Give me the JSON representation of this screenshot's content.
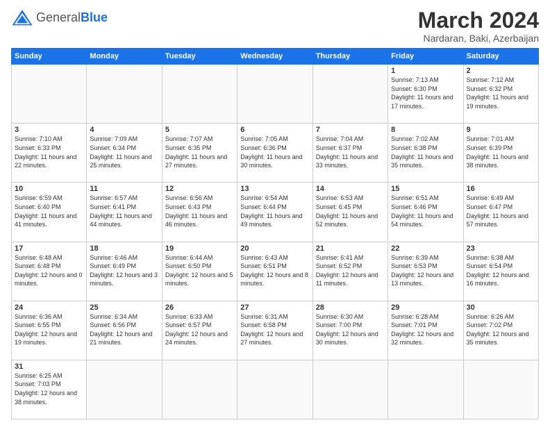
{
  "header": {
    "logo_general": "General",
    "logo_blue": "Blue",
    "title": "March 2024",
    "subtitle": "Nardaran, Baki, Azerbaijan"
  },
  "weekdays": [
    "Sunday",
    "Monday",
    "Tuesday",
    "Wednesday",
    "Thursday",
    "Friday",
    "Saturday"
  ],
  "weeks": [
    [
      {
        "day": "",
        "info": ""
      },
      {
        "day": "",
        "info": ""
      },
      {
        "day": "",
        "info": ""
      },
      {
        "day": "",
        "info": ""
      },
      {
        "day": "",
        "info": ""
      },
      {
        "day": "1",
        "info": "Sunrise: 7:13 AM\nSunset: 6:30 PM\nDaylight: 11 hours\nand 17 minutes."
      },
      {
        "day": "2",
        "info": "Sunrise: 7:12 AM\nSunset: 6:32 PM\nDaylight: 11 hours\nand 19 minutes."
      }
    ],
    [
      {
        "day": "3",
        "info": "Sunrise: 7:10 AM\nSunset: 6:33 PM\nDaylight: 11 hours\nand 22 minutes."
      },
      {
        "day": "4",
        "info": "Sunrise: 7:09 AM\nSunset: 6:34 PM\nDaylight: 11 hours\nand 25 minutes."
      },
      {
        "day": "5",
        "info": "Sunrise: 7:07 AM\nSunset: 6:35 PM\nDaylight: 11 hours\nand 27 minutes."
      },
      {
        "day": "6",
        "info": "Sunrise: 7:05 AM\nSunset: 6:36 PM\nDaylight: 11 hours\nand 30 minutes."
      },
      {
        "day": "7",
        "info": "Sunrise: 7:04 AM\nSunset: 6:37 PM\nDaylight: 11 hours\nand 33 minutes."
      },
      {
        "day": "8",
        "info": "Sunrise: 7:02 AM\nSunset: 6:38 PM\nDaylight: 11 hours\nand 35 minutes."
      },
      {
        "day": "9",
        "info": "Sunrise: 7:01 AM\nSunset: 6:39 PM\nDaylight: 11 hours\nand 38 minutes."
      }
    ],
    [
      {
        "day": "10",
        "info": "Sunrise: 6:59 AM\nSunset: 6:40 PM\nDaylight: 11 hours\nand 41 minutes."
      },
      {
        "day": "11",
        "info": "Sunrise: 6:57 AM\nSunset: 6:41 PM\nDaylight: 11 hours\nand 44 minutes."
      },
      {
        "day": "12",
        "info": "Sunrise: 6:56 AM\nSunset: 6:43 PM\nDaylight: 11 hours\nand 46 minutes."
      },
      {
        "day": "13",
        "info": "Sunrise: 6:54 AM\nSunset: 6:44 PM\nDaylight: 11 hours\nand 49 minutes."
      },
      {
        "day": "14",
        "info": "Sunrise: 6:53 AM\nSunset: 6:45 PM\nDaylight: 11 hours\nand 52 minutes."
      },
      {
        "day": "15",
        "info": "Sunrise: 6:51 AM\nSunset: 6:46 PM\nDaylight: 11 hours\nand 54 minutes."
      },
      {
        "day": "16",
        "info": "Sunrise: 6:49 AM\nSunset: 6:47 PM\nDaylight: 11 hours\nand 57 minutes."
      }
    ],
    [
      {
        "day": "17",
        "info": "Sunrise: 6:48 AM\nSunset: 6:48 PM\nDaylight: 12 hours\nand 0 minutes."
      },
      {
        "day": "18",
        "info": "Sunrise: 6:46 AM\nSunset: 6:49 PM\nDaylight: 12 hours\nand 3 minutes."
      },
      {
        "day": "19",
        "info": "Sunrise: 6:44 AM\nSunset: 6:50 PM\nDaylight: 12 hours\nand 5 minutes."
      },
      {
        "day": "20",
        "info": "Sunrise: 6:43 AM\nSunset: 6:51 PM\nDaylight: 12 hours\nand 8 minutes."
      },
      {
        "day": "21",
        "info": "Sunrise: 6:41 AM\nSunset: 6:52 PM\nDaylight: 12 hours\nand 11 minutes."
      },
      {
        "day": "22",
        "info": "Sunrise: 6:39 AM\nSunset: 6:53 PM\nDaylight: 12 hours\nand 13 minutes."
      },
      {
        "day": "23",
        "info": "Sunrise: 6:38 AM\nSunset: 6:54 PM\nDaylight: 12 hours\nand 16 minutes."
      }
    ],
    [
      {
        "day": "24",
        "info": "Sunrise: 6:36 AM\nSunset: 6:55 PM\nDaylight: 12 hours\nand 19 minutes."
      },
      {
        "day": "25",
        "info": "Sunrise: 6:34 AM\nSunset: 6:56 PM\nDaylight: 12 hours\nand 21 minutes."
      },
      {
        "day": "26",
        "info": "Sunrise: 6:33 AM\nSunset: 6:57 PM\nDaylight: 12 hours\nand 24 minutes."
      },
      {
        "day": "27",
        "info": "Sunrise: 6:31 AM\nSunset: 6:58 PM\nDaylight: 12 hours\nand 27 minutes."
      },
      {
        "day": "28",
        "info": "Sunrise: 6:30 AM\nSunset: 7:00 PM\nDaylight: 12 hours\nand 30 minutes."
      },
      {
        "day": "29",
        "info": "Sunrise: 6:28 AM\nSunset: 7:01 PM\nDaylight: 12 hours\nand 32 minutes."
      },
      {
        "day": "30",
        "info": "Sunrise: 6:26 AM\nSunset: 7:02 PM\nDaylight: 12 hours\nand 35 minutes."
      }
    ],
    [
      {
        "day": "31",
        "info": "Sunrise: 6:25 AM\nSunset: 7:03 PM\nDaylight: 12 hours\nand 38 minutes."
      },
      {
        "day": "",
        "info": ""
      },
      {
        "day": "",
        "info": ""
      },
      {
        "day": "",
        "info": ""
      },
      {
        "day": "",
        "info": ""
      },
      {
        "day": "",
        "info": ""
      },
      {
        "day": "",
        "info": ""
      }
    ]
  ]
}
